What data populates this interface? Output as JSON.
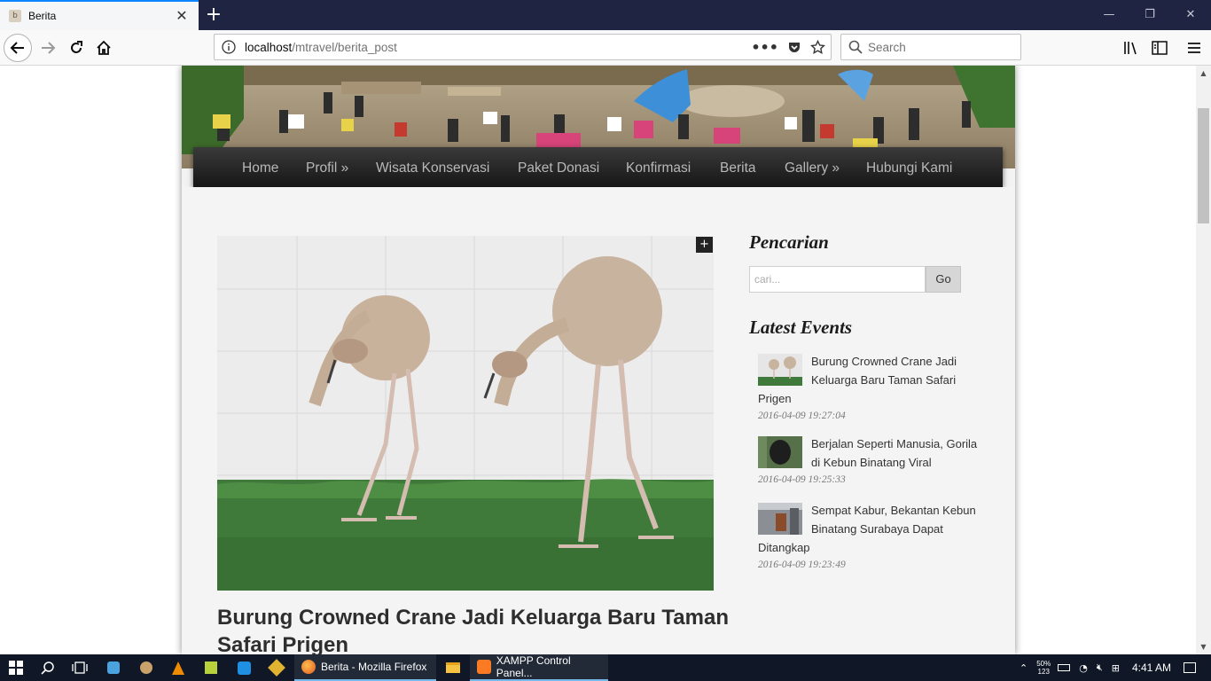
{
  "browser": {
    "tab_title": "Berita",
    "tab_favicon_letter": "b",
    "url_host": "localhost",
    "url_path": "/mtravel/berita_post",
    "search_placeholder": "Search",
    "window_title": "Berita - Mozilla Firefox"
  },
  "site": {
    "menu": [
      {
        "label": "Home"
      },
      {
        "label": "Profil »"
      },
      {
        "label": "Wisata Konservasi"
      },
      {
        "label": "Paket Donasi"
      },
      {
        "label": "Konfirmasi"
      },
      {
        "label": "Berita"
      },
      {
        "label": "Gallery »"
      },
      {
        "label": "Hubungi Kami"
      }
    ],
    "post": {
      "title": "Burung Crowned Crane Jadi Keluarga Baru Taman Safari Prigen",
      "expand_label": "+"
    },
    "sidebar": {
      "search_title": "Pencarian",
      "search_placeholder": "cari...",
      "search_button": "Go",
      "events_title": "Latest Events",
      "events": [
        {
          "title": "Burung Crowned Crane Jadi Keluarga Baru Taman Safari Prigen",
          "date": "2016-04-09 19:27:04"
        },
        {
          "title": "Berjalan Seperti Manusia, Gorila di Kebun Binatang Viral",
          "date": "2016-04-09 19:25:33"
        },
        {
          "title": "Sempat Kabur, Bekantan Kebun Binatang Surabaya Dapat Ditangkap",
          "date": "2016-04-09 19:23:49"
        }
      ]
    }
  },
  "taskbar": {
    "apps": [
      {
        "label": "Berita - Mozilla Firefox"
      },
      {
        "label": "XAMPP Control Panel..."
      }
    ],
    "time": "4:41 AM",
    "battery_top": "50%",
    "battery_bottom": "123"
  }
}
